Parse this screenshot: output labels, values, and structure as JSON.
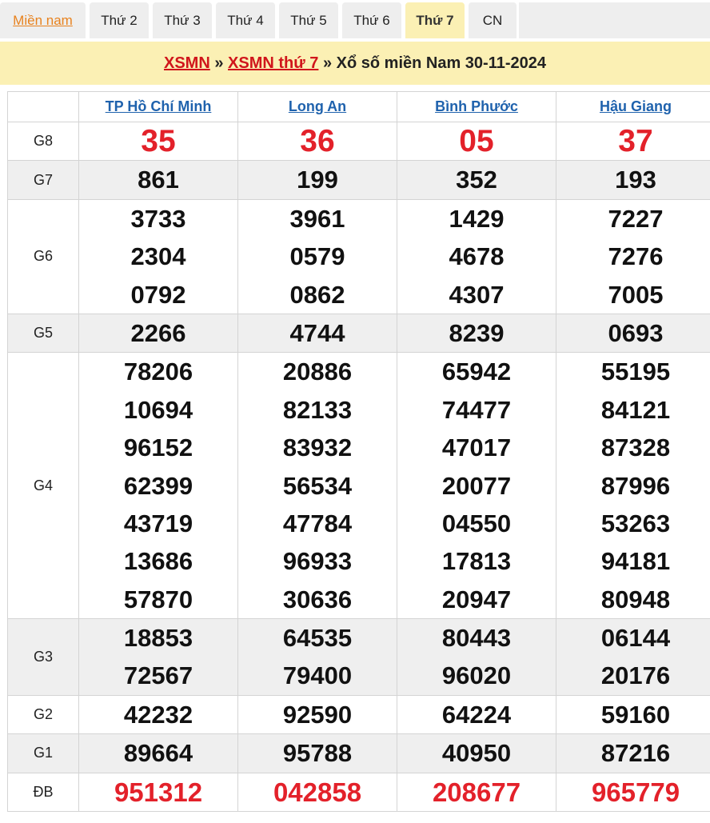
{
  "tabs": [
    {
      "label": "Miền nam"
    },
    {
      "label": "Thứ 2"
    },
    {
      "label": "Thứ 3"
    },
    {
      "label": "Thứ 4"
    },
    {
      "label": "Thứ 5"
    },
    {
      "label": "Thứ 6"
    },
    {
      "label": "Thứ 7"
    },
    {
      "label": "CN"
    }
  ],
  "active_tab": "Thứ 7",
  "title": {
    "link1": "XSMN",
    "sep1": " » ",
    "link2": "XSMN thứ 7",
    "rest": " » Xổ số miền Nam 30-11-2024"
  },
  "colors": {
    "accent_red": "#d0151b",
    "prize_red": "#e3212a",
    "link_blue": "#1f62ad",
    "tab_home_orange": "#e8821e",
    "highlight_yellow": "#fbf0b4"
  },
  "provinces": [
    "TP Hồ Chí Minh",
    "Long An",
    "Bình Phước",
    "Hậu Giang"
  ],
  "prizes": [
    {
      "label": "G8",
      "values": [
        [
          "35"
        ],
        [
          "36"
        ],
        [
          "05"
        ],
        [
          "37"
        ]
      ]
    },
    {
      "label": "G7",
      "values": [
        [
          "861"
        ],
        [
          "199"
        ],
        [
          "352"
        ],
        [
          "193"
        ]
      ]
    },
    {
      "label": "G6",
      "values": [
        [
          "3733",
          "2304",
          "0792"
        ],
        [
          "3961",
          "0579",
          "0862"
        ],
        [
          "1429",
          "4678",
          "4307"
        ],
        [
          "7227",
          "7276",
          "7005"
        ]
      ]
    },
    {
      "label": "G5",
      "values": [
        [
          "2266"
        ],
        [
          "4744"
        ],
        [
          "8239"
        ],
        [
          "0693"
        ]
      ]
    },
    {
      "label": "G4",
      "values": [
        [
          "78206",
          "10694",
          "96152",
          "62399",
          "43719",
          "13686",
          "57870"
        ],
        [
          "20886",
          "82133",
          "83932",
          "56534",
          "47784",
          "96933",
          "30636"
        ],
        [
          "65942",
          "74477",
          "47017",
          "20077",
          "04550",
          "17813",
          "20947"
        ],
        [
          "55195",
          "84121",
          "87328",
          "87996",
          "53263",
          "94181",
          "80948"
        ]
      ]
    },
    {
      "label": "G3",
      "values": [
        [
          "18853",
          "72567"
        ],
        [
          "64535",
          "79400"
        ],
        [
          "80443",
          "96020"
        ],
        [
          "06144",
          "20176"
        ]
      ]
    },
    {
      "label": "G2",
      "values": [
        [
          "42232"
        ],
        [
          "92590"
        ],
        [
          "64224"
        ],
        [
          "59160"
        ]
      ]
    },
    {
      "label": "G1",
      "values": [
        [
          "89664"
        ],
        [
          "95788"
        ],
        [
          "40950"
        ],
        [
          "87216"
        ]
      ]
    },
    {
      "label": "ĐB",
      "values": [
        [
          "951312"
        ],
        [
          "042858"
        ],
        [
          "208677"
        ],
        [
          "965779"
        ]
      ]
    }
  ]
}
